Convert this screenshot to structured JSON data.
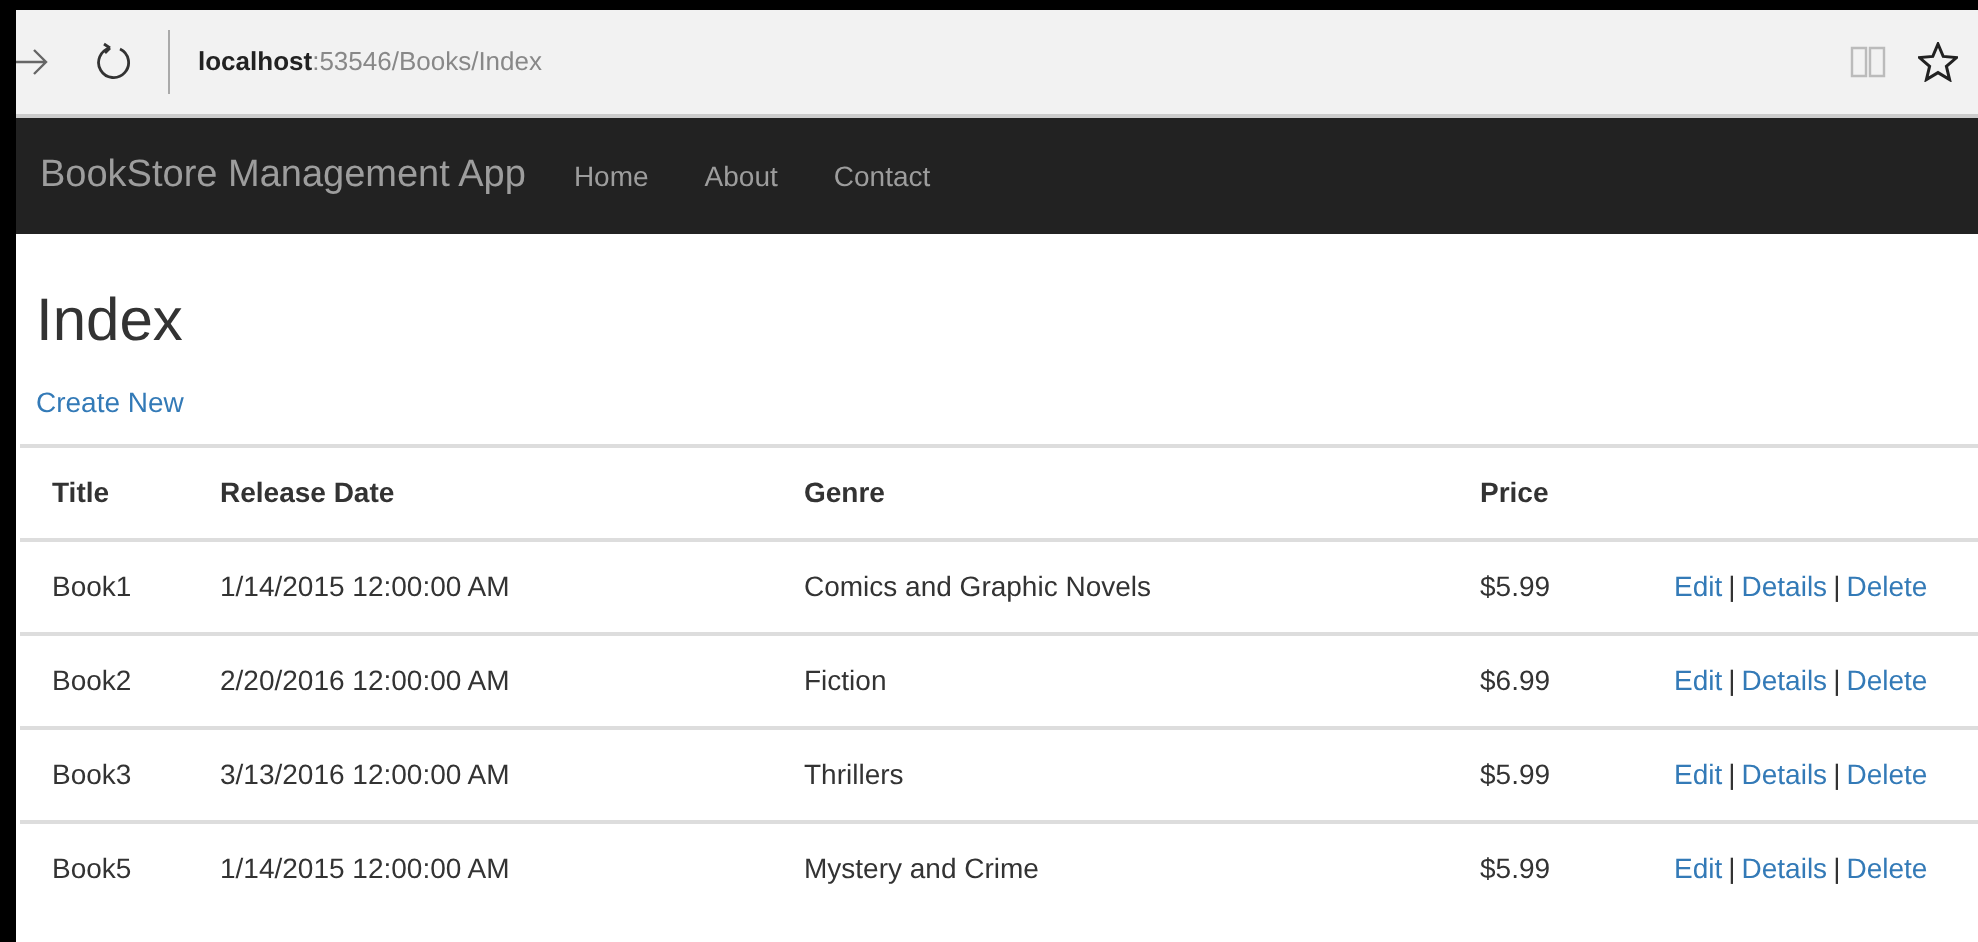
{
  "browser": {
    "address": "**localhost**:53546/Books/Index"
  },
  "navbar": {
    "brand": "BookStore Management App",
    "links": [
      "Home",
      "About",
      "Contact"
    ]
  },
  "page": {
    "title": "Index",
    "create_link": "Create New"
  },
  "table": {
    "columns": [
      "Title",
      "Release Date",
      "Genre",
      "Price"
    ],
    "rows": [
      {
        "title": "Book1",
        "release_date": "1/14/2015 12:00:00 AM",
        "genre": "Comics and Graphic Novels",
        "price": "$5.99",
        "actions": [
          "Edit",
          "Details",
          "Delete"
        ],
        "separators": [
          "|",
          "|"
        ]
      },
      {
        "title": "Book2",
        "release_date": "2/20/2016 12:00:00 AM",
        "genre": "Fiction",
        "price": "$6.99",
        "actions": [
          "Edit",
          "Details",
          "Delete"
        ],
        "separators": [
          "|",
          "|"
        ]
      },
      {
        "title": "Book3",
        "release_date": "3/13/2016 12:00:00 AM",
        "genre": "Thrillers",
        "price": "$5.99",
        "actions": [
          "Edit",
          "Details",
          "Delete"
        ],
        "separators": [
          "|",
          "|"
        ]
      },
      {
        "title": "Book5",
        "release_date": "1/14/2015 12:00:00 AM",
        "genre": "Mystery and Crime",
        "price": "$5.99",
        "actions": [
          "Edit",
          "Details",
          "Delete"
        ],
        "separators": [
          "|",
          "|"
        ]
      }
    ]
  }
}
